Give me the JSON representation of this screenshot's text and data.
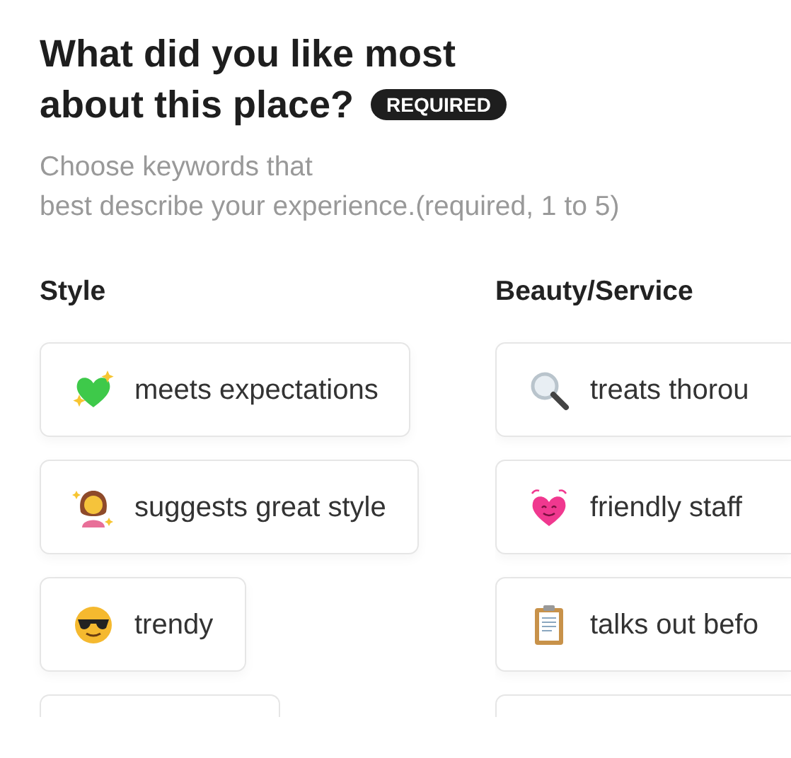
{
  "question": {
    "title_lines": [
      "What did you like most",
      "about this place?"
    ],
    "badge": "REQUIRED",
    "hint": "Choose keywords that\nbest describe your experience.(required, 1 to 5)"
  },
  "columns": [
    {
      "title": "Style",
      "items": [
        {
          "kind": "chip",
          "label": "meets expectations"
        },
        {
          "kind": "chip",
          "label": "suggests great style"
        },
        {
          "kind": "chip",
          "label": "trendy"
        },
        {
          "kind": "cut"
        }
      ]
    },
    {
      "title": "Beauty/Service",
      "items": [
        {
          "kind": "chip",
          "label": "treats thorou"
        },
        {
          "kind": "chip",
          "label": "friendly staff"
        },
        {
          "kind": "chip",
          "label": "talks out befo"
        },
        {
          "kind": "cut"
        }
      ]
    }
  ]
}
